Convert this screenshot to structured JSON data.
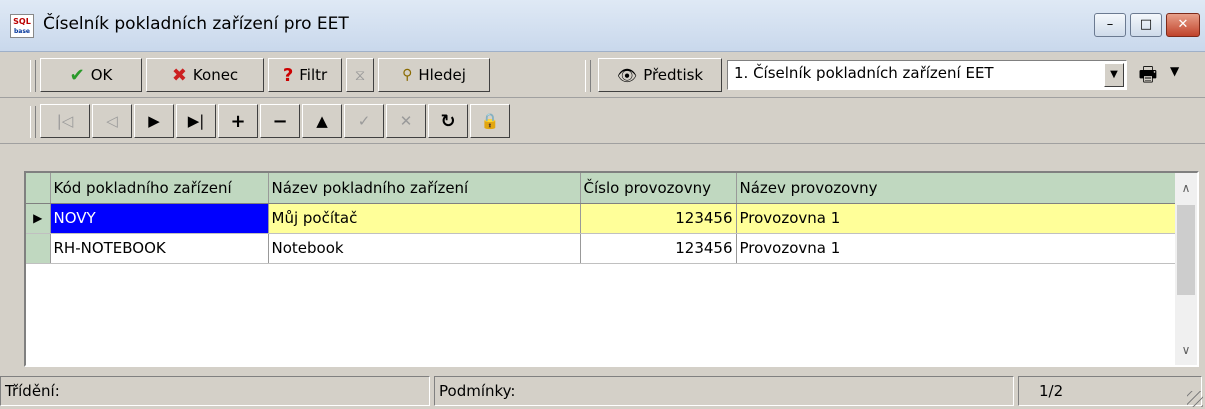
{
  "window": {
    "title": "Číselník pokladních zařízení pro EET",
    "icon_text_top": "SQL",
    "icon_text_bottom": "base",
    "minimize": "–",
    "maximize": "□",
    "close": "✕"
  },
  "toolbar": {
    "ok_label": "OK",
    "konec_label": "Konec",
    "filtr_label": "Filtr",
    "hledej_label": "Hledej",
    "predtisk_label": "Předtisk",
    "report_selected": "1. Číselník pokladních zařízení EET"
  },
  "nav": {
    "first": "|◁",
    "prev": "◁",
    "next": "▶",
    "last": "▶|",
    "add": "+",
    "delete": "−",
    "edit": "▲",
    "post": "✓",
    "cancel": "✕",
    "refresh": "↻",
    "lock": "🔒"
  },
  "grid": {
    "columns": [
      "Kód pokladního zařízení",
      "Název pokladního zařízení",
      "Číslo provozovny",
      "Název provozovny"
    ],
    "rows": [
      {
        "kod": "NOVY",
        "nazev": "Můj počítač",
        "cislo": "123456",
        "provozovna": "Provozovna 1"
      },
      {
        "kod": "RH-NOTEBOOK",
        "nazev": "Notebook",
        "cislo": "123456",
        "provozovna": "Provozovna 1"
      }
    ]
  },
  "status": {
    "trideni": "Třídění:",
    "podminky": "Podmínky:",
    "record": "1/2"
  }
}
